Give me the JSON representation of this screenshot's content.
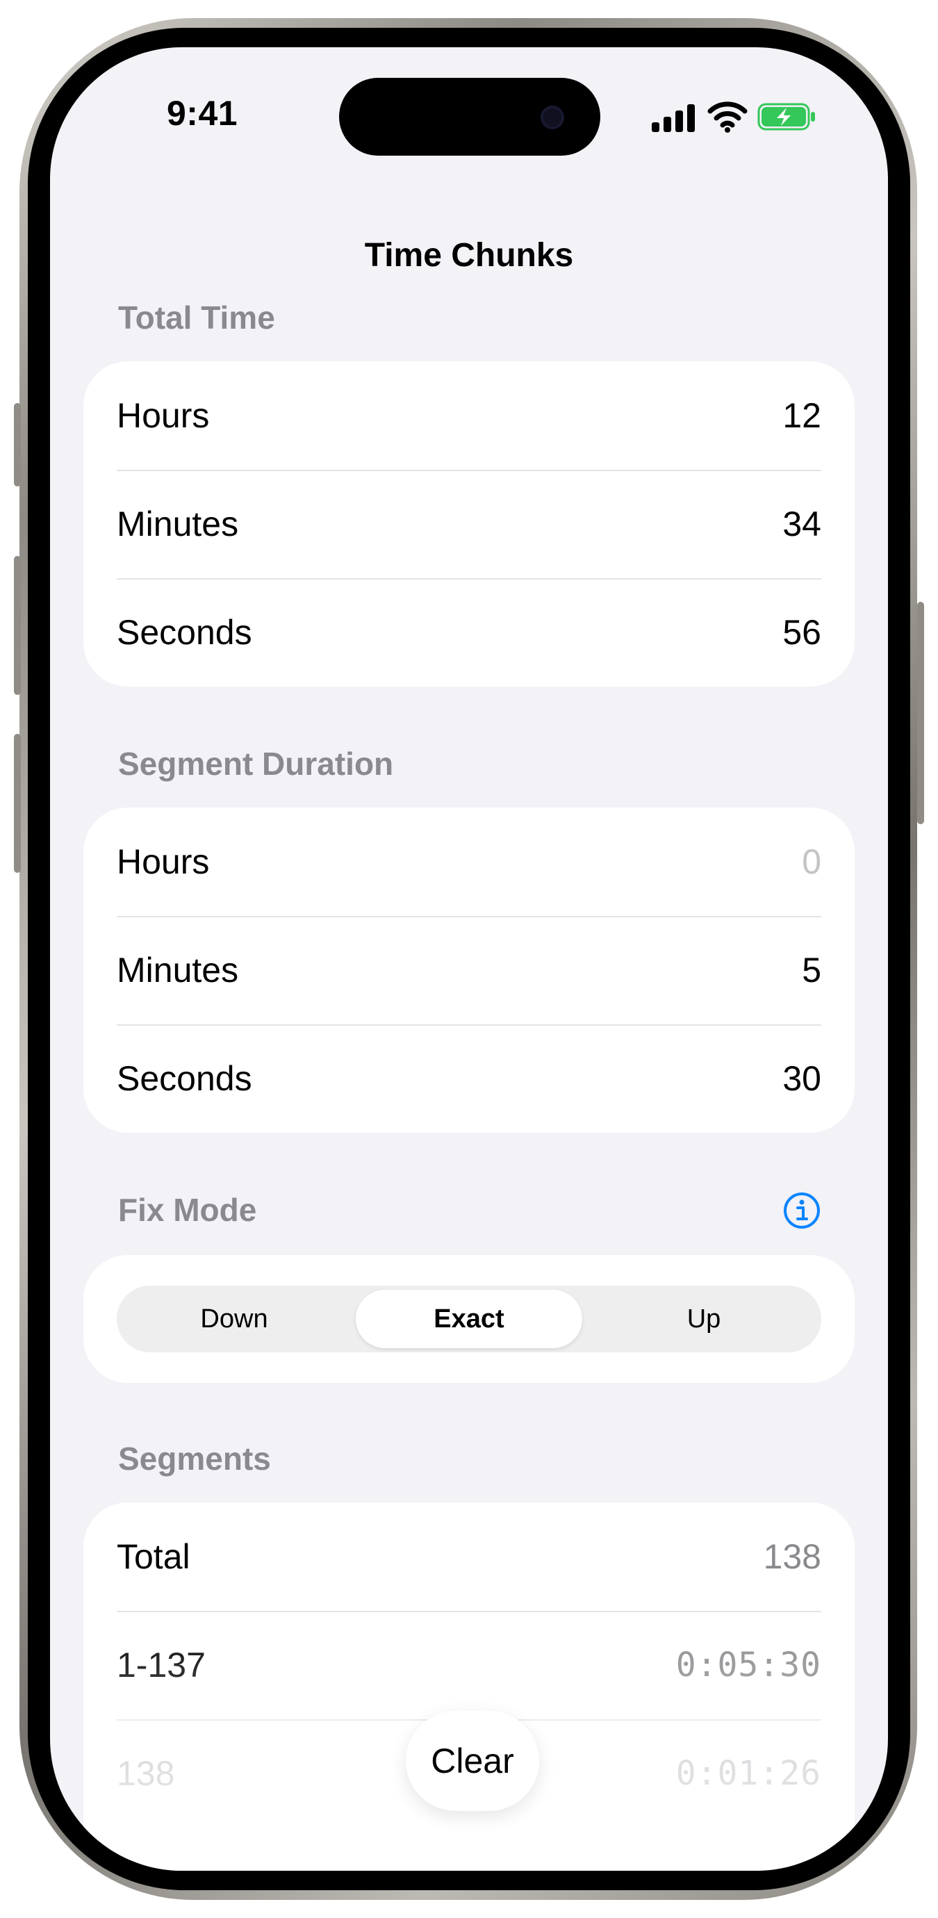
{
  "status_bar": {
    "time": "9:41",
    "icons": [
      "signal-icon",
      "wifi-icon",
      "battery-charging-icon"
    ]
  },
  "nav": {
    "title": "Time Chunks"
  },
  "total_time": {
    "header": "Total Time",
    "rows": [
      {
        "label": "Hours",
        "value": "12"
      },
      {
        "label": "Minutes",
        "value": "34"
      },
      {
        "label": "Seconds",
        "value": "56"
      }
    ]
  },
  "segment_duration": {
    "header": "Segment Duration",
    "rows": [
      {
        "label": "Hours",
        "value": "0"
      },
      {
        "label": "Minutes",
        "value": "5"
      },
      {
        "label": "Seconds",
        "value": "30"
      }
    ]
  },
  "fix_mode": {
    "header": "Fix Mode",
    "options": [
      "Down",
      "Exact",
      "Up"
    ],
    "selected": "Exact"
  },
  "segments": {
    "header": "Segments",
    "rows": [
      {
        "label": "Total",
        "value": "138"
      },
      {
        "label": "1-137",
        "value": "0:05:30"
      },
      {
        "label": "138",
        "value": "0:01:26"
      }
    ]
  },
  "actions": {
    "clear_label": "Clear"
  },
  "colors": {
    "accent": "#0a84ff",
    "background": "#f2f2f7",
    "battery_fill": "#34c759"
  }
}
